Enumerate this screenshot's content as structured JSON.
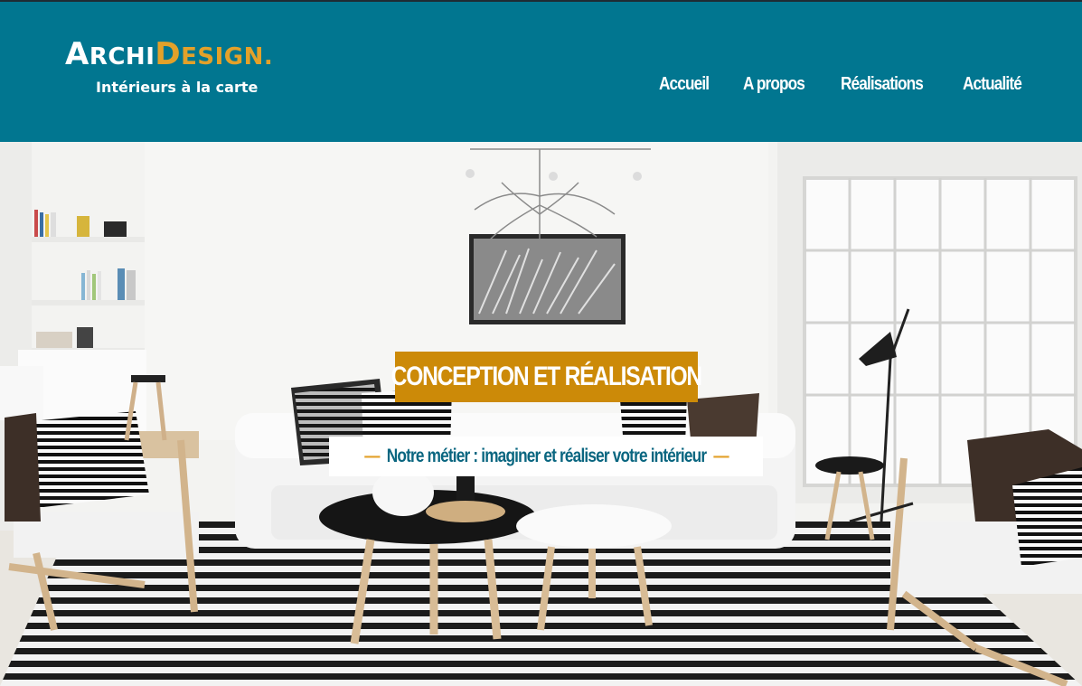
{
  "brand": {
    "logo_a": "A",
    "logo_rchi": "RCHI",
    "logo_d": "D",
    "logo_esign": "ESIGN.",
    "tagline": "Intérieurs à la carte"
  },
  "nav": {
    "items": [
      {
        "label": "Accueil"
      },
      {
        "label": "A propos"
      },
      {
        "label": "Réalisations"
      },
      {
        "label": "Actualité"
      }
    ]
  },
  "hero": {
    "title": "CONCEPTION ET RÉALISATION",
    "subtitle": "Notre métier : imaginer et réaliser votre intérieur",
    "dash_left": "—",
    "dash_right": "—"
  },
  "colors": {
    "header_bg": "#017690",
    "accent": "#cc8a08",
    "logo_accent": "#e3a12a",
    "subtitle_text": "#0a6680"
  }
}
